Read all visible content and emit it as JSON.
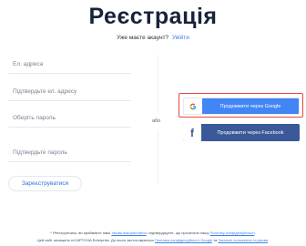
{
  "page": {
    "title": "Реєстрація",
    "subtitle": {
      "text": "Уже маєте акаунт?",
      "link": "Увійти"
    }
  },
  "form": {
    "fields": [
      {
        "placeholder": "Ел. адреса",
        "value": ""
      },
      {
        "placeholder": "Підтвердьте ел. адресу",
        "value": ""
      },
      {
        "placeholder": "Оберіть пароль",
        "value": ""
      },
      {
        "placeholder": "Підтвердьте пароль",
        "value": ""
      }
    ],
    "register_label": "Зареєструватися"
  },
  "separator": {
    "or_label": "або"
  },
  "social": {
    "google": {
      "label": "Продовжити через Google",
      "icon": "google-g-icon"
    },
    "facebook": {
      "label": "Продовжити через Facebook",
      "icon": "facebook-f-icon"
    }
  },
  "footer": {
    "line1": {
      "prefix": "* Реєструючись, ви приймаєте наші",
      "terms_link": "Умови використання",
      "middle": "і підтверджуєте, що прочитали нашу",
      "privacy_link": "Політику конфіденційності",
      "suffix": "."
    },
    "line2": {
      "prefix": "Цей сайт захищено reCAPTCHA Enterprise. До нього застосовуються",
      "google_privacy_link": "Політика конфіденційності Google",
      "middle": "та",
      "google_terms_link": "Загальні положення та умови",
      "suffix": "."
    }
  },
  "colors": {
    "accent": "#3a82ee",
    "google_blue": "#4285f4",
    "facebook_blue": "#3b5998",
    "highlight_red": "#e8463d",
    "title": "#17223b"
  }
}
